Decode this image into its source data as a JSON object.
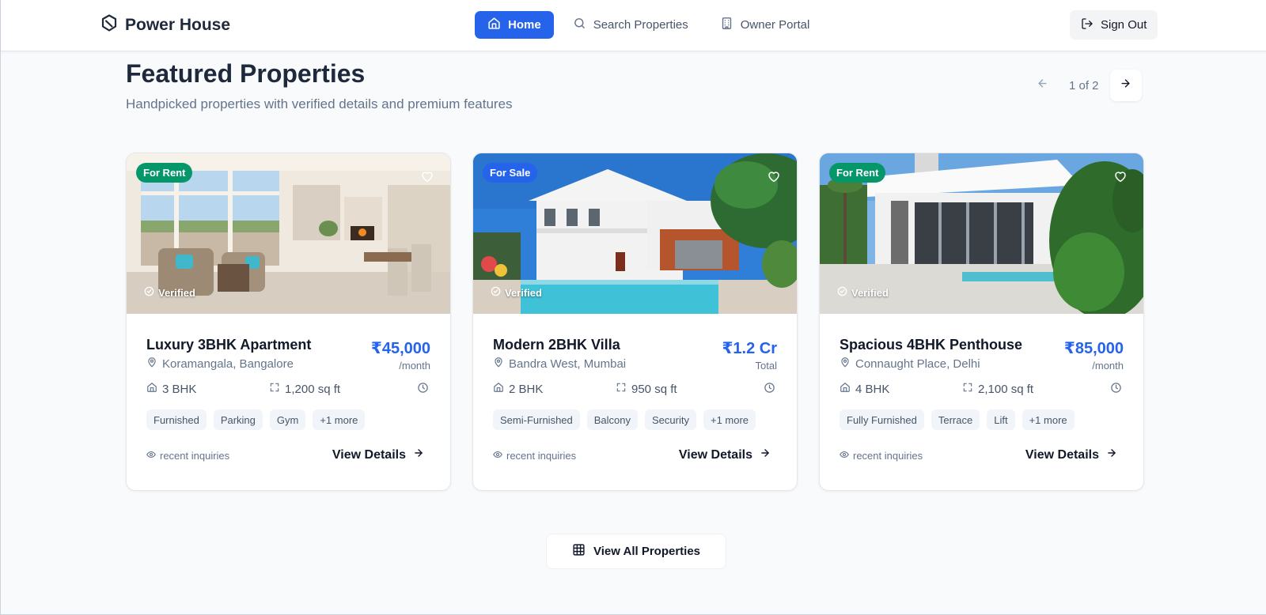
{
  "brand": {
    "name": "Power House",
    "icon": "hexagon-logo-icon"
  },
  "nav": {
    "items": [
      {
        "label": "Home",
        "icon": "home-icon",
        "active": true
      },
      {
        "label": "Search Properties",
        "icon": "search-icon",
        "active": false
      },
      {
        "label": "Owner Portal",
        "icon": "building-icon",
        "active": false
      }
    ],
    "signout_label": "Sign Out"
  },
  "section": {
    "title": "Featured Properties",
    "subtitle": "Handpicked properties with verified details and premium features"
  },
  "pager": {
    "text": "1 of 2"
  },
  "cards": [
    {
      "badge": "For Rent",
      "badge_color": "#059669",
      "verified": "Verified",
      "title": "Luxury 3BHK Apartment",
      "location": "Koramangala, Bangalore",
      "price": "₹45,000",
      "period": "/month",
      "beds": "3 BHK",
      "area": "1,200 sq ft",
      "tags": [
        "Furnished",
        "Parking",
        "Gym",
        "+1 more"
      ],
      "inquiries": "recent inquiries",
      "cta": "View Details"
    },
    {
      "badge": "For Sale",
      "badge_color": "#2563eb",
      "verified": "Verified",
      "title": "Modern 2BHK Villa",
      "location": "Bandra West, Mumbai",
      "price": "₹1.2 Cr",
      "period": "Total",
      "beds": "2 BHK",
      "area": "950 sq ft",
      "tags": [
        "Semi-Furnished",
        "Balcony",
        "Security",
        "+1 more"
      ],
      "inquiries": "recent inquiries",
      "cta": "View Details"
    },
    {
      "badge": "For Rent",
      "badge_color": "#059669",
      "verified": "Verified",
      "title": "Spacious 4BHK Penthouse",
      "location": "Connaught Place, Delhi",
      "price": "₹85,000",
      "period": "/month",
      "beds": "4 BHK",
      "area": "2,100 sq ft",
      "tags": [
        "Fully Furnished",
        "Terrace",
        "Lift",
        "+1 more"
      ],
      "inquiries": "recent inquiries",
      "cta": "View Details"
    }
  ],
  "view_all_label": "View All Properties",
  "colors": {
    "primary": "#2563eb",
    "rent": "#059669",
    "text": "#1e293b",
    "muted": "#64748b"
  }
}
